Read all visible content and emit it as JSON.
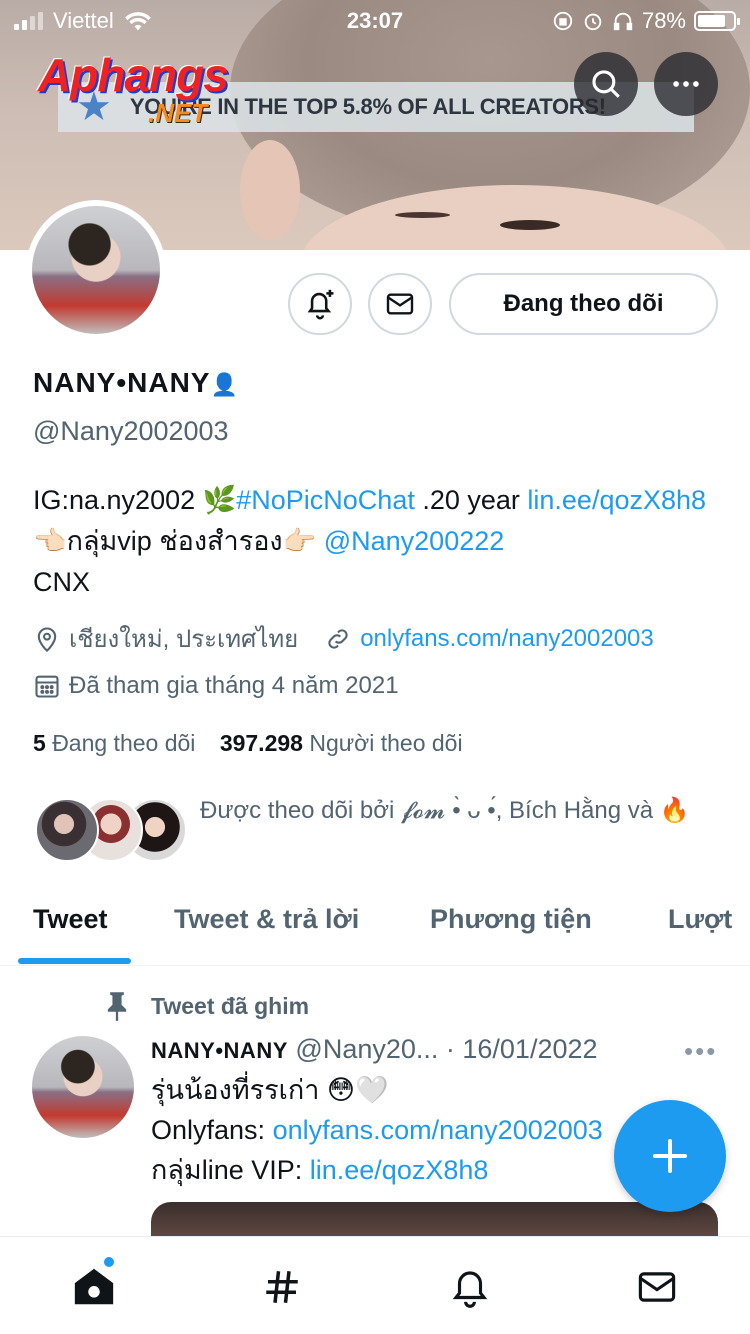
{
  "status_bar": {
    "carrier": "Viettel",
    "time": "23:07",
    "battery": "78%",
    "battery_level": 0.78
  },
  "banner": {
    "creator_text": "YOU'RE IN THE TOP 5.8% OF ALL CREATORS!",
    "watermark_main": "Aphangs",
    "watermark_sub": ".NET"
  },
  "profile": {
    "follow_button": "Đang theo dõi",
    "display_name": "NANY•NANY",
    "display_name_suffix": "👤",
    "handle": "@Nany2002003",
    "bio": {
      "t1": "IG:na.ny2002 🌿",
      "hashtag": "#NoPicNoChat",
      "t2": " .20 year ",
      "link1": "lin.ee/qozX8h8",
      "t3": "👈🏻กลุ่มvip ช่องสำรอง👉🏻 ",
      "mention": "@Nany200222",
      "t4": "CNX"
    },
    "location": "เชียงใหม่, ประเทศไทย",
    "website": "onlyfans.com/nany2002003",
    "joined": "Đã tham gia tháng 4 năm 2021",
    "following_count": "5",
    "following_label": "Đang theo dõi",
    "followers_count": "397.298",
    "followers_label": "Người theo dõi",
    "followed_by": "Được theo dõi bởi 𝓯𝓸𝓶 •̀ ᴗ •́, Bích Hằng và 🔥"
  },
  "tabs": [
    "Tweet",
    "Tweet & trả lời",
    "Phương tiện",
    "Lượt"
  ],
  "tweet": {
    "pinned_label": "Tweet đã ghim",
    "name": "NANY•NANY",
    "handle_date": "@Nany20... · 16/01/2022",
    "line1": "รุ่นน้องที่รรเก่า 😳🤍",
    "line2_prefix": "Onlyfans: ",
    "line2_link": "onlyfans.com/nany2002003",
    "line3_prefix": "กลุ่มline VIP: ",
    "line3_link": "lin.ee/qozX8h8",
    "more": "•••"
  }
}
